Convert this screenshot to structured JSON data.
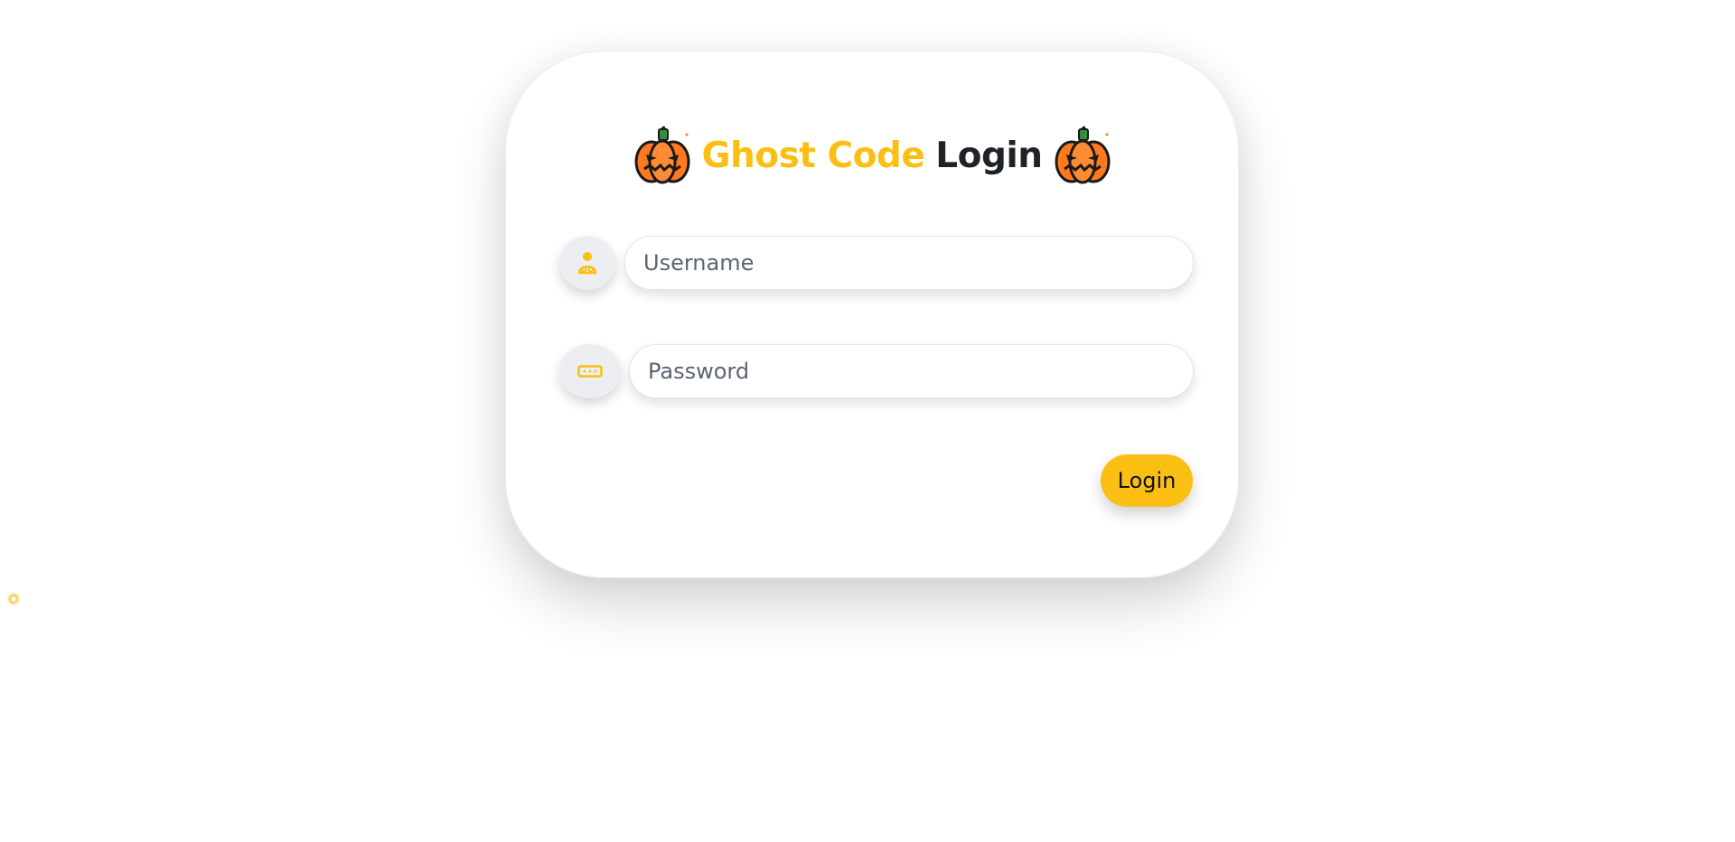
{
  "header": {
    "brand": "Ghost Code",
    "title_rest": "Login",
    "decoration_icon": "pumpkin-icon"
  },
  "form": {
    "username": {
      "placeholder": "Username",
      "value": "",
      "icon": "user-icon"
    },
    "password": {
      "placeholder": "Password",
      "value": "",
      "icon": "key-icon"
    },
    "submit_label": "Login"
  },
  "colors": {
    "accent": "#fbbf13",
    "text_dark": "#1f2328",
    "icon_bg": "#eceef1",
    "pumpkin": "#ff7a1f"
  }
}
